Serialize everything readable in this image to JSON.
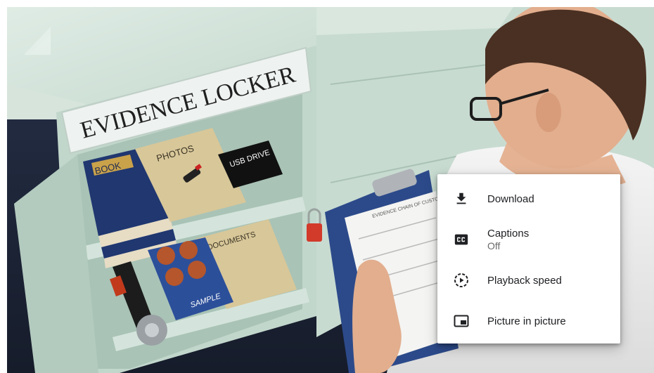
{
  "video": {
    "locker_sign": "EVIDENCE LOCKER",
    "shelf_labels": {
      "book": "BOOK",
      "photos": "PHOTOS",
      "usb": "USB DRIVE",
      "documents": "DOCUMENTS",
      "sample": "SAMPLE"
    },
    "clipboard_heading": "EVIDENCE CHAIN OF CUSTODY FORM"
  },
  "context_menu": {
    "items": [
      {
        "id": "download",
        "label": "Download",
        "icon": "download-icon"
      },
      {
        "id": "captions",
        "label": "Captions",
        "sublabel": "Off",
        "icon": "closed-captions-icon"
      },
      {
        "id": "playback-speed",
        "label": "Playback speed",
        "icon": "playback-speed-icon"
      },
      {
        "id": "picture-in-picture",
        "label": "Picture in picture",
        "icon": "picture-in-picture-icon"
      }
    ]
  },
  "colors": {
    "menu_background": "#ffffff",
    "menu_text": "#202124",
    "menu_subtext": "#6a6a6a",
    "cabinet": "#c9dcd2",
    "carpet": "#1e2636"
  }
}
